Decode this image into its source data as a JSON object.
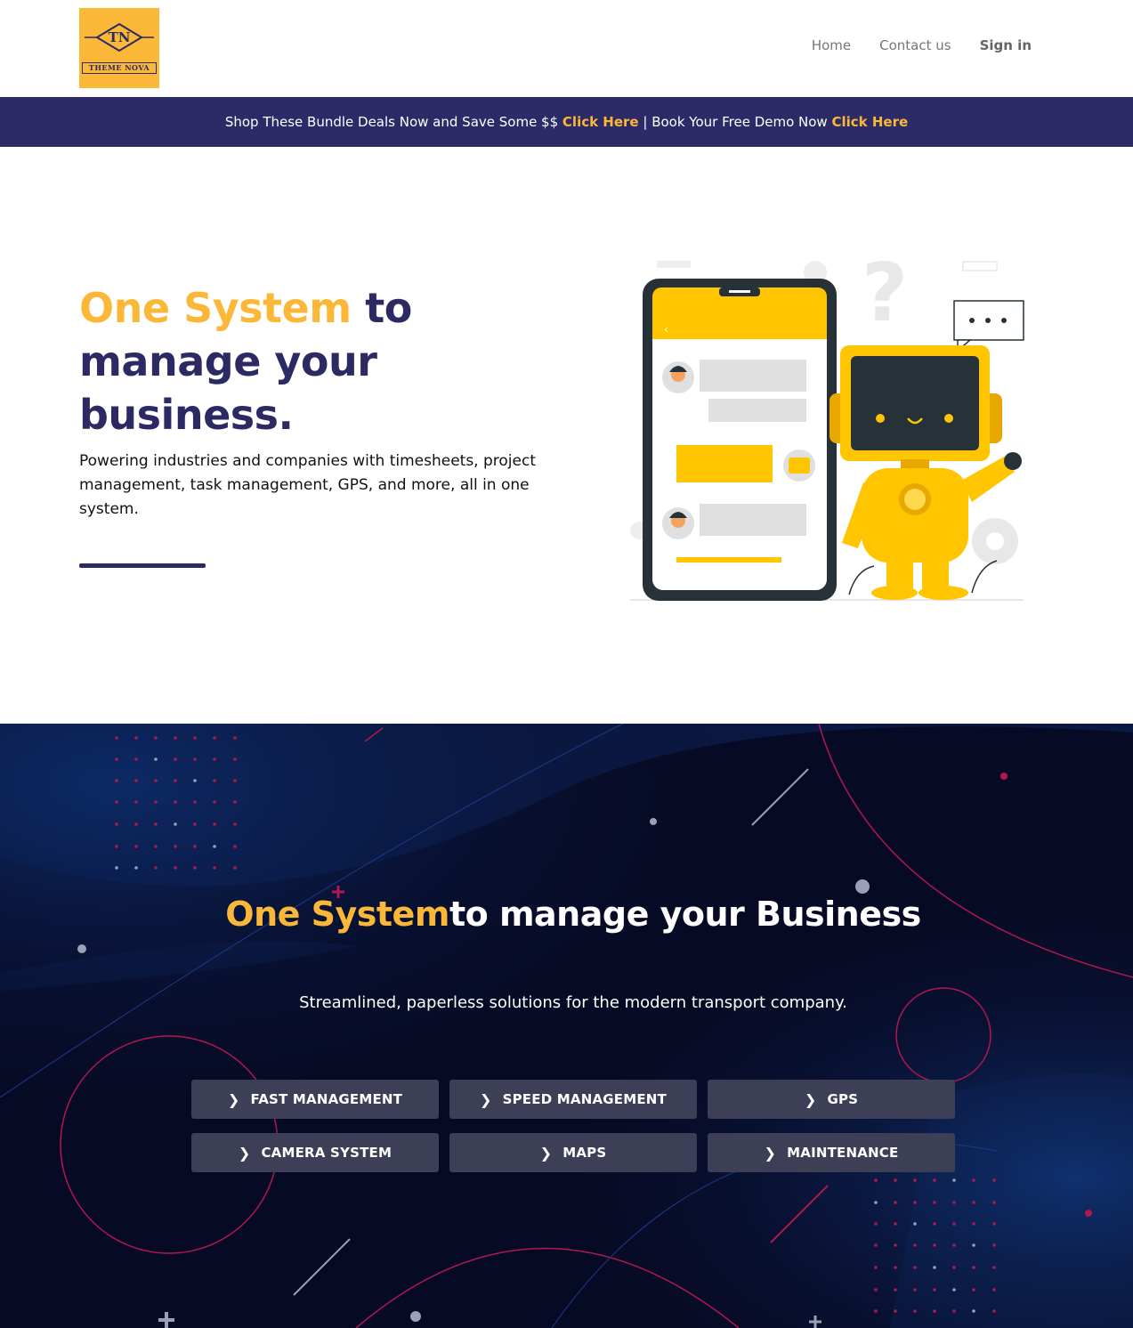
{
  "header": {
    "logo": {
      "monogram": "TN",
      "wordmark": "THEME NOVA"
    },
    "nav": [
      {
        "label": "Home"
      },
      {
        "label": "Contact us"
      },
      {
        "label": "Sign in"
      }
    ]
  },
  "promo": {
    "text1": "Shop These Bundle Deals Now and Save Some $$ ",
    "link1": "Click Here",
    "text2": " | Book Your Free Demo Now ",
    "link2": "Click Here"
  },
  "hero": {
    "title_accent": "One System",
    "title_rest": " to manage your business.",
    "subtitle": "Powering industries and companies with timesheets, project management, task management, GPS, and more, all in one system."
  },
  "features": {
    "title_accent": "One System",
    "title_rest": "to manage your Business",
    "subtitle": "Streamlined, paperless solutions for the modern transport company.",
    "buttons": [
      {
        "label": "FAST MANAGEMENT",
        "icon": "chevron-right-icon"
      },
      {
        "label": "SPEED MANAGEMENT",
        "icon": "chevron-right-icon"
      },
      {
        "label": "GPS",
        "icon": "chevron-right-icon"
      },
      {
        "label": "CAMERA SYSTEM",
        "icon": "chevron-right-icon"
      },
      {
        "label": "MAPS",
        "icon": "chevron-right-icon"
      },
      {
        "label": "MAINTENANCE",
        "icon": "chevron-right-icon"
      }
    ]
  },
  "colors": {
    "brand_navy": "#2b2a63",
    "accent_yellow": "#fbb838",
    "dark_bg": "#070a24",
    "button_bg": "#3c3f55"
  }
}
